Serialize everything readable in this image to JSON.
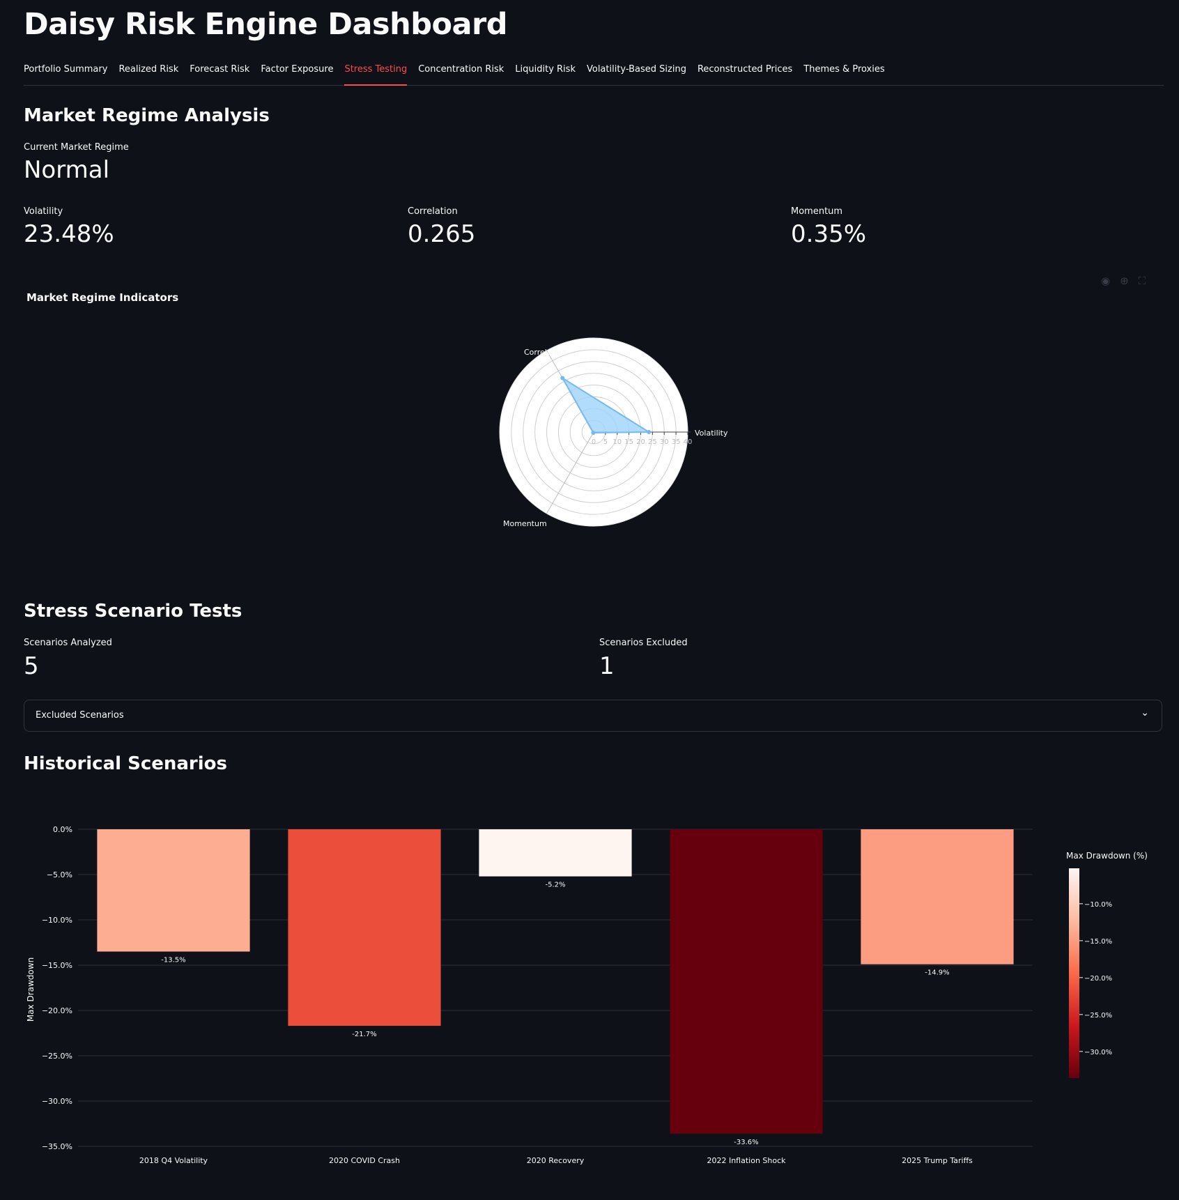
{
  "app": {
    "title": "Daisy Risk Engine Dashboard"
  },
  "tabs": [
    {
      "label": "Portfolio Summary"
    },
    {
      "label": "Realized Risk"
    },
    {
      "label": "Forecast Risk"
    },
    {
      "label": "Factor Exposure"
    },
    {
      "label": "Stress Testing",
      "active": true
    },
    {
      "label": "Concentration Risk"
    },
    {
      "label": "Liquidity Risk"
    },
    {
      "label": "Volatility-Based Sizing"
    },
    {
      "label": "Reconstructed Prices"
    },
    {
      "label": "Themes & Proxies"
    }
  ],
  "regime": {
    "heading": "Market Regime Analysis",
    "current_label": "Current Market Regime",
    "current_value": "Normal",
    "metrics": [
      {
        "label": "Volatility",
        "value": "23.48%"
      },
      {
        "label": "Correlation",
        "value": "0.265"
      },
      {
        "label": "Momentum",
        "value": "0.35%"
      }
    ],
    "chart_title": "Market Regime Indicators"
  },
  "stress": {
    "heading": "Stress Scenario Tests",
    "analyzed_label": "Scenarios Analyzed",
    "analyzed_value": "5",
    "excluded_label": "Scenarios Excluded",
    "excluded_value": "1",
    "expander_label": "Excluded Scenarios"
  },
  "historical": {
    "heading": "Historical Scenarios"
  },
  "colors": {
    "accent": "#ff4b4b",
    "background": "#0e1117",
    "radar_fill": "#9fd3fb"
  },
  "icons": [
    "camera-icon",
    "zoom-icon",
    "fullscreen-icon",
    "chevron-down-icon"
  ],
  "chart_data": [
    {
      "type": "radar",
      "title": "Market Regime Indicators",
      "axes": [
        "Volatility",
        "Correlation",
        "Momentum"
      ],
      "values": [
        23.48,
        26.5,
        0.35
      ],
      "radial_ticks": [
        "0",
        "5",
        "10",
        "15",
        "20",
        "25",
        "30",
        "35",
        "40"
      ],
      "range": [
        0,
        40
      ]
    },
    {
      "type": "bar",
      "categories": [
        "2018 Q4 Volatility",
        "2020 COVID Crash",
        "2020 Recovery",
        "2022 Inflation Shock",
        "2025 Trump Tariffs"
      ],
      "values": [
        -13.5,
        -21.7,
        -5.2,
        -33.6,
        -14.9
      ],
      "data_labels": [
        "-13.5%",
        "-21.7%",
        "-5.2%",
        "-33.6%",
        "-14.9%"
      ],
      "ylabel": "Max Drawdown",
      "ylim": [
        -35,
        0
      ],
      "yticks": [
        "0.0%",
        "−5.0%",
        "−10.0%",
        "−15.0%",
        "−20.0%",
        "−25.0%",
        "−30.0%",
        "−35.0%"
      ],
      "yticks_values": [
        0,
        -5,
        -10,
        -15,
        -20,
        -25,
        -30,
        -35
      ],
      "colorbar": {
        "title": "Max Drawdown (%)",
        "ticks": [
          "−10.0%",
          "−15.0%",
          "−20.0%",
          "−25.0%",
          "−30.0%"
        ],
        "tick_values": [
          -10,
          -15,
          -20,
          -25,
          -30
        ],
        "range": [
          -33.6,
          -5.2
        ],
        "colorscale": "Reds (reversed)"
      }
    }
  ]
}
